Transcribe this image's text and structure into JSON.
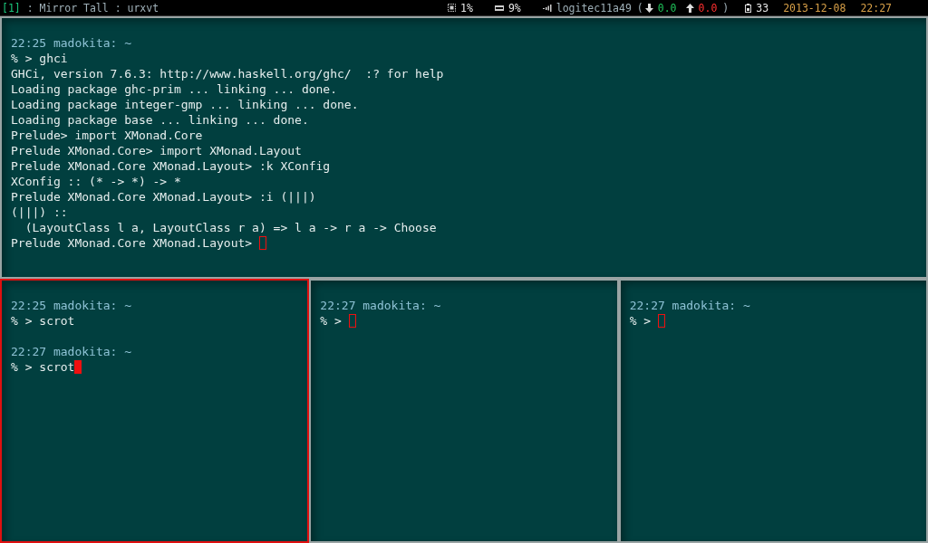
{
  "status_bar": {
    "workspace": "[1]",
    "layout_title": ": Mirror Tall : urxvt",
    "cpu": "1%",
    "memory": "9%",
    "network": "logitec11a49",
    "open_paren": "(",
    "down_rate": "0.0",
    "up_rate": "0.0",
    "close_paren": ")",
    "battery": "33",
    "date": "2013-12-08",
    "time": "22:27"
  },
  "windows": [
    {
      "focused": false,
      "lines": [
        {
          "kind": "blank"
        },
        {
          "kind": "header",
          "text": "22:25 madokita: ~"
        },
        {
          "kind": "output",
          "text": "% > ghci"
        },
        {
          "kind": "output",
          "text": "GHCi, version 7.6.3: http://www.haskell.org/ghc/  :? for help"
        },
        {
          "kind": "output",
          "text": "Loading package ghc-prim ... linking ... done."
        },
        {
          "kind": "output",
          "text": "Loading package integer-gmp ... linking ... done."
        },
        {
          "kind": "output",
          "text": "Loading package base ... linking ... done."
        },
        {
          "kind": "output",
          "text": "Prelude> import XMonad.Core"
        },
        {
          "kind": "output",
          "text": "Prelude XMonad.Core> import XMonad.Layout"
        },
        {
          "kind": "output",
          "text": "Prelude XMonad.Core XMonad.Layout> :k XConfig"
        },
        {
          "kind": "output",
          "text": "XConfig :: (* -> *) -> *"
        },
        {
          "kind": "output",
          "text": "Prelude XMonad.Core XMonad.Layout> :i (|||)"
        },
        {
          "kind": "output",
          "text": "(|||) ::"
        },
        {
          "kind": "output",
          "text": "  (LayoutClass l a, LayoutClass r a) => l a -> r a -> Choose"
        },
        {
          "kind": "output",
          "text": "Prelude XMonad.Core XMonad.Layout> "
        }
      ]
    },
    {
      "focused": true,
      "lines": [
        {
          "kind": "blank"
        },
        {
          "kind": "header",
          "text": "22:25 madokita: ~"
        },
        {
          "kind": "output",
          "text": "% > scrot"
        },
        {
          "kind": "blank"
        },
        {
          "kind": "header",
          "text": "22:27 madokita: ~"
        },
        {
          "kind": "output",
          "text": "% > scrot"
        }
      ]
    },
    {
      "focused": false,
      "lines": [
        {
          "kind": "blank"
        },
        {
          "kind": "header",
          "text": "22:27 madokita: ~"
        },
        {
          "kind": "output",
          "text": "% > "
        }
      ]
    },
    {
      "focused": false,
      "lines": [
        {
          "kind": "blank"
        },
        {
          "kind": "header",
          "text": "22:27 madokita: ~"
        },
        {
          "kind": "output",
          "text": "% > "
        }
      ]
    }
  ]
}
